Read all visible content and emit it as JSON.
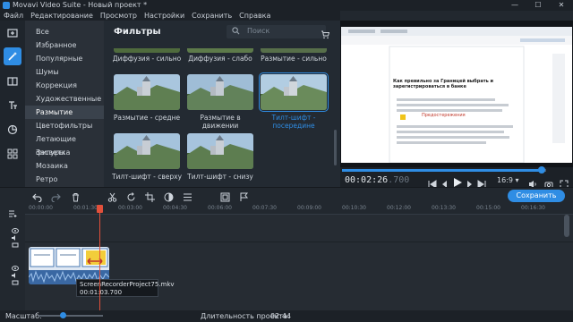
{
  "app": {
    "title": "Movavi Video Suite - Новый проект *",
    "window_controls": [
      "—",
      "☐",
      "✕"
    ]
  },
  "menu": [
    "Файл",
    "Редактирование",
    "Просмотр",
    "Настройки",
    "Сохранить",
    "Справка"
  ],
  "tools": [
    "import-icon",
    "filters-icon",
    "transitions-icon",
    "titles-icon",
    "stickers-icon",
    "more-tools-icon"
  ],
  "categories": [
    "Все",
    "Избранное",
    "Популярные",
    "Шумы",
    "Коррекция",
    "Художественные",
    "Размытие",
    "Цветофильтры",
    "Летающие фигуры",
    "Засветка",
    "Мозаика",
    "Ретро"
  ],
  "selected_category": "Размытие",
  "panel": {
    "title": "Фильтры",
    "search_placeholder": "Поиск"
  },
  "filters_top_row": [
    "Диффузия - сильно",
    "Диффузия - слабо",
    "Размытие - сильно"
  ],
  "filters": [
    {
      "label": "Размытие - средне",
      "selected": false
    },
    {
      "label": "Размытие в движении",
      "selected": false
    },
    {
      "label": "Тилт-шифт - посередине",
      "selected": true
    },
    {
      "label": "Тилт-шифт - сверху",
      "selected": false
    },
    {
      "label": "Тилт-шифт - снизу",
      "selected": false
    }
  ],
  "preview": {
    "time_main": "00:02:26",
    "time_ms": ".700",
    "aspect": "16:9",
    "progress": 0.98,
    "doc_heading": "Как превильно за Границей выбрать и зарегистрироваться в банке",
    "doc_subheading": "Предостережения"
  },
  "timeline": {
    "save_label": "Сохранить",
    "ruler": [
      "00:00:00",
      "00:01:30",
      "00:03:00",
      "00:04:30",
      "00:06:00",
      "00:07:30",
      "00:09:00",
      "00:10:30",
      "00:12:00",
      "00:13:30",
      "00:15:00",
      "00:16:30"
    ],
    "clip_name": "ScreenRecorderProject75.mkv",
    "clip_time": "00:01:03.700"
  },
  "status": {
    "zoom_label": "Масштаб:",
    "zoom_level": 0.38,
    "duration_label": "Длительность проекта:",
    "duration_value": "02:44"
  },
  "colors": {
    "accent": "#2f8de4",
    "playhead": "#e2503b"
  }
}
